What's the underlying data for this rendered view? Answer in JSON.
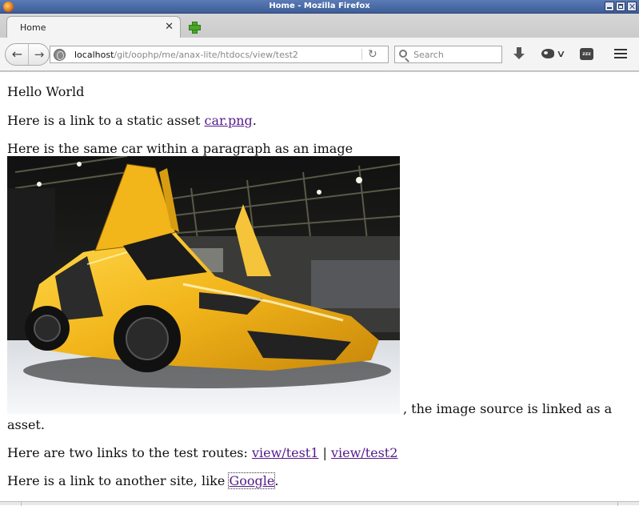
{
  "window": {
    "title": "Home - Mozilla Firefox"
  },
  "tabs": [
    {
      "label": "Home",
      "active": true
    }
  ],
  "toolbar": {
    "url_host": "localhost",
    "url_path": "/git/oophp/me/anax-lite/htdocs/view/test2",
    "search_placeholder": "Search",
    "zzz_label": "zzz"
  },
  "page": {
    "hello": "Hello World",
    "static_prefix": "Here is a link to a static asset ",
    "static_link": "car.png",
    "static_suffix": ".",
    "image_intro": "Here is the same car within a paragraph as an image",
    "image_after": ", the image source is linked as a",
    "image_after_line2": "asset.",
    "routes_prefix": "Here are two links to the test routes: ",
    "route1": "view/test1",
    "route_sep": " | ",
    "route2": "view/test2",
    "google_prefix": "Here is a link to another site, like ",
    "google_link": "Google",
    "google_suffix": "."
  },
  "colors": {
    "link_visited": "#551a8b",
    "titlebar": "#4a6aa6",
    "car_yellow": "#f2b51a"
  }
}
